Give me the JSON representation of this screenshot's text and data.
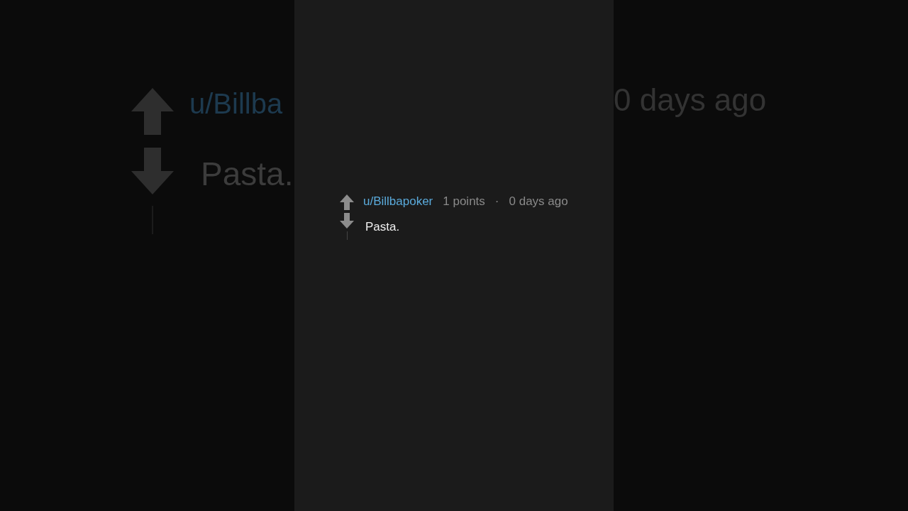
{
  "backdrop": {
    "username": "u/Billba",
    "body": "Pasta.",
    "time": "0 days ago"
  },
  "comment": {
    "username": "u/Billbapoker",
    "points": "1 points",
    "separator": "·",
    "time": "0 days ago",
    "body": "Pasta."
  }
}
